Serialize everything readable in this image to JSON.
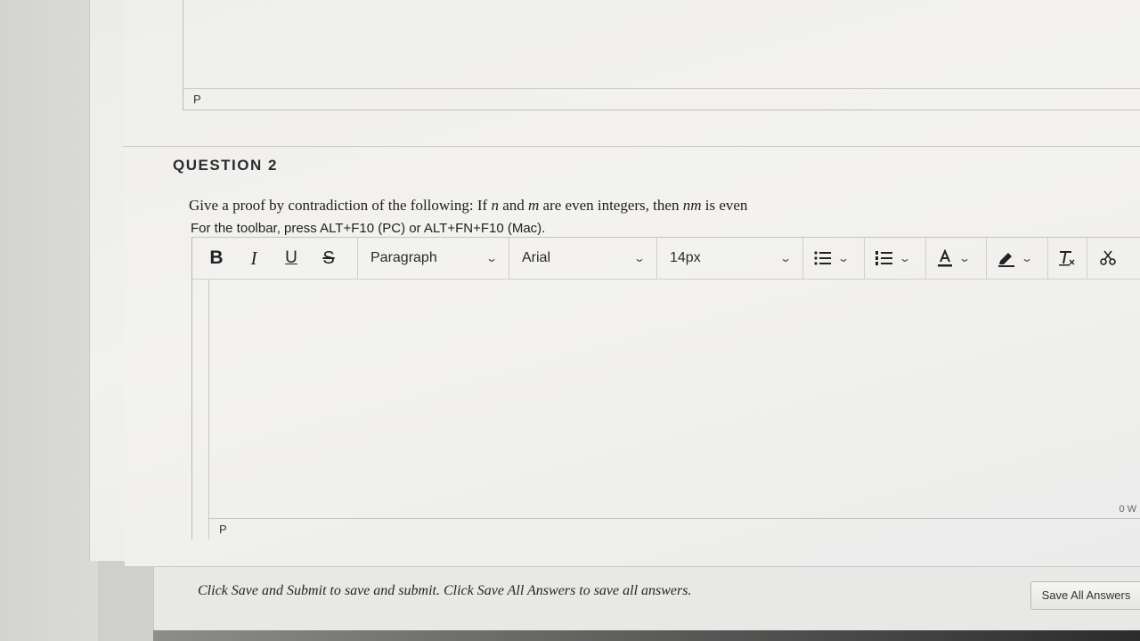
{
  "previous_editor": {
    "status_path": "P"
  },
  "question": {
    "title": "QUESTION 2",
    "text_part1": "Give a proof by contradiction of the following: If ",
    "var_n": "n",
    "text_and": " and ",
    "var_m": "m",
    "text_part2": " are even integers, then ",
    "var_nm": "nm",
    "text_part3": " is even",
    "toolbar_hint": "For the toolbar, press ALT+F10 (PC) or ALT+FN+F10 (Mac)."
  },
  "toolbar": {
    "bold": "B",
    "italic": "I",
    "underline": "U",
    "strikethrough": "S",
    "block_format": "Paragraph",
    "font_family": "Arial",
    "font_size": "14px",
    "chevron": "⌄"
  },
  "editor": {
    "status_path": "P",
    "word_count": "0 W"
  },
  "footer": {
    "message": "Click Save and Submit to save and submit. Click Save All Answers to save all answers.",
    "save_all_label": "Save All Answers"
  }
}
